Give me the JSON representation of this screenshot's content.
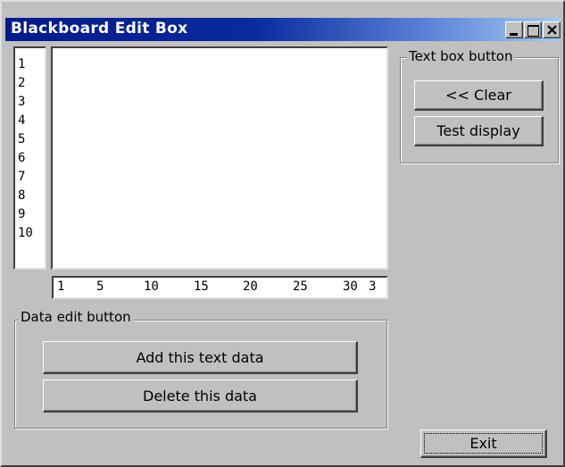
{
  "window": {
    "title": "Blackboard Edit Box"
  },
  "line_numbers": [
    "1",
    "2",
    "3",
    "4",
    "5",
    "6",
    "7",
    "8",
    "9",
    "10"
  ],
  "text_area": {
    "value": ""
  },
  "ruler": {
    "marks": [
      "1",
      "5",
      "10",
      "15",
      "20",
      "25",
      "30",
      "3"
    ]
  },
  "text_box_group": {
    "label": "Text box button",
    "clear_label": "<< Clear",
    "test_display_label": "Test display"
  },
  "data_edit_group": {
    "label": "Data edit button",
    "add_label": "Add this text data",
    "delete_label": "Delete this data"
  },
  "exit_label": "Exit"
}
